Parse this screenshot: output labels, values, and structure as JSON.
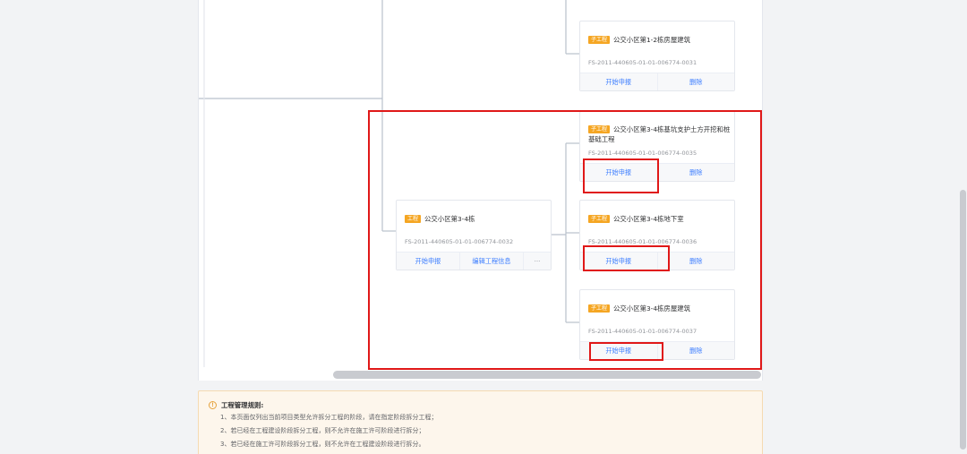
{
  "cards": [
    {
      "badge": "子工程",
      "title": "公交小区第1-2栋房屋建筑",
      "code": "FS-2011-440605-01-01-006774-0031",
      "actions": [
        "开始申报",
        "删除"
      ]
    },
    {
      "badge": "子工程",
      "title": "公交小区第3-4栋基坑支护土方开挖和桩基础工程",
      "code": "FS-2011-440605-01-01-006774-0035",
      "actions": [
        "开始申报",
        "删除"
      ]
    },
    {
      "badge": "工程",
      "title": "公交小区第3-4栋",
      "code": "FS-2011-440605-01-01-006774-0032",
      "actions": [
        "开始申报",
        "编辑工程信息",
        "···"
      ]
    },
    {
      "badge": "子工程",
      "title": "公交小区第3-4栋地下室",
      "code": "FS-2011-440605-01-01-006774-0036",
      "actions": [
        "开始申报",
        "删除"
      ]
    },
    {
      "badge": "子工程",
      "title": "公交小区第3-4栋房屋建筑",
      "code": "FS-2011-440605-01-01-006774-0037",
      "actions": [
        "开始申报",
        "删除"
      ]
    }
  ],
  "notice": {
    "title": "工程管理规则:",
    "rules": [
      "1、本页面仅列出当前项目类型允许拆分工程的阶段，请在指定阶段拆分工程；",
      "2、若已经在工程建设阶段拆分工程，则不允许在施工许可阶段进行拆分；",
      "3、若已经在施工许可阶段拆分工程，则不允许在工程建设阶段进行拆分。"
    ]
  },
  "colors": {
    "accent": "#3d7eff",
    "badge": "#f5a623",
    "highlight": "#e01818",
    "connector": "#b9c1cc"
  }
}
